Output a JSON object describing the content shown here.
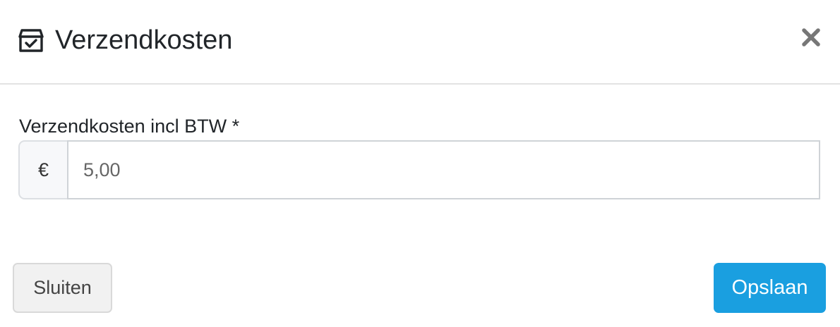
{
  "modal": {
    "title": "Verzendkosten",
    "title_icon": "box-check-icon",
    "close_icon": "close-icon"
  },
  "form": {
    "field_label": "Verzendkosten incl BTW *",
    "currency_symbol": "€",
    "amount_value": "5,00"
  },
  "footer": {
    "close_label": "Sluiten",
    "save_label": "Opslaan"
  },
  "colors": {
    "primary": "#1a9fe0",
    "secondary_bg": "#f1f1f1",
    "close_icon": "#777777"
  }
}
